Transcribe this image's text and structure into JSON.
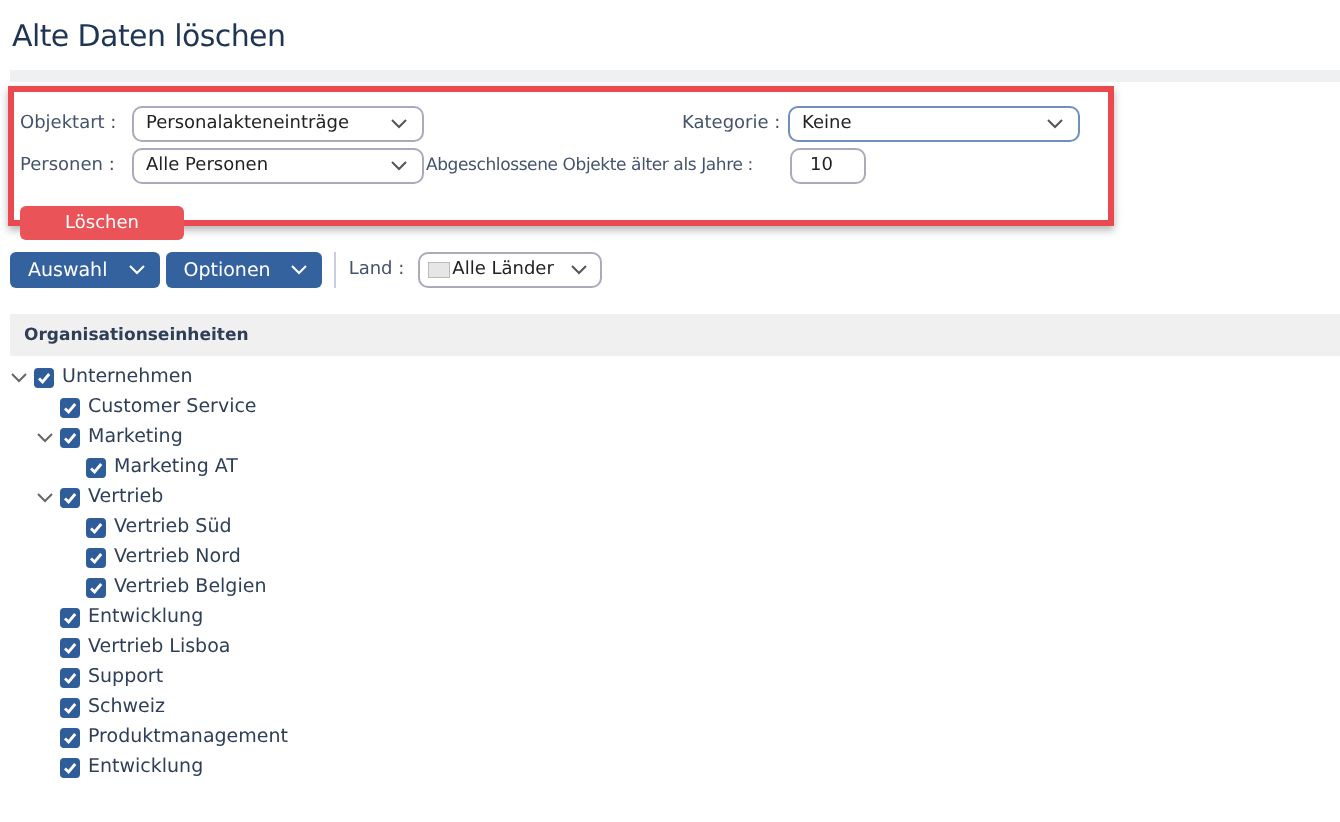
{
  "page": {
    "title": "Alte Daten löschen"
  },
  "filters": {
    "objektart": {
      "label": "Objektart :",
      "value": "Personalakteneinträge"
    },
    "kategorie": {
      "label": "Kategorie :",
      "value": "Keine",
      "focused": true
    },
    "personen": {
      "label": "Personen :",
      "value": "Alle Personen"
    },
    "jahre": {
      "label": "Abgeschlossene Objekte älter als Jahre :",
      "value": "10"
    },
    "delete_button": "Löschen"
  },
  "toolbar": {
    "buttons": [
      "Auswahl",
      "Optionen"
    ],
    "land": {
      "label": "Land :",
      "value": "Alle Länder"
    }
  },
  "tree": {
    "header": "Organisationseinheiten",
    "items": [
      {
        "label": "Unternehmen",
        "checked": true,
        "expanded": true,
        "children": [
          {
            "label": "Customer Service",
            "checked": true
          },
          {
            "label": "Marketing",
            "checked": true,
            "expanded": true,
            "children": [
              {
                "label": "Marketing AT",
                "checked": true
              }
            ]
          },
          {
            "label": "Vertrieb",
            "checked": true,
            "expanded": true,
            "children": [
              {
                "label": "Vertrieb Süd",
                "checked": true
              },
              {
                "label": "Vertrieb Nord",
                "checked": true
              },
              {
                "label": "Vertrieb Belgien",
                "checked": true
              }
            ]
          },
          {
            "label": "Entwicklung",
            "checked": true
          },
          {
            "label": "Vertrieb Lisboa",
            "checked": true
          },
          {
            "label": "Support",
            "checked": true
          },
          {
            "label": "Schweiz",
            "checked": true
          },
          {
            "label": "Produktmanagement",
            "checked": true
          },
          {
            "label": "Entwicklung",
            "checked": true
          }
        ]
      }
    ]
  }
}
